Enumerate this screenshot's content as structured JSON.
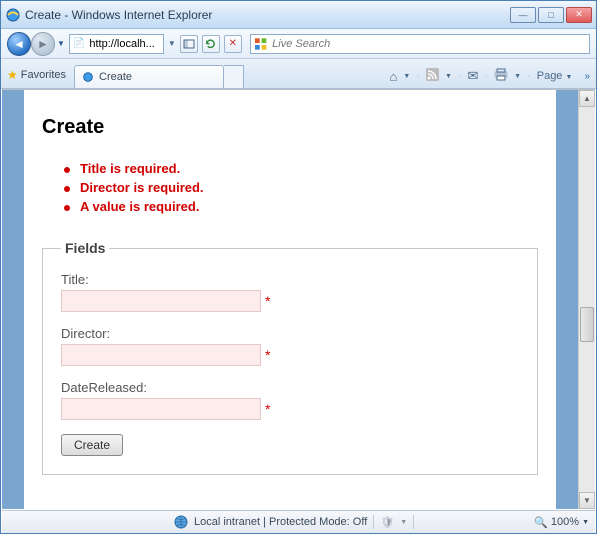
{
  "window": {
    "title": "Create - Windows Internet Explorer"
  },
  "nav": {
    "url": "http://localh...",
    "search_placeholder": "Live Search"
  },
  "tabs": {
    "favorites_label": "Favorites",
    "active_tab_title": "Create"
  },
  "toolbar": {
    "page_menu": "Page"
  },
  "page": {
    "heading": "Create",
    "errors": [
      "Title is required.",
      "Director is required.",
      "A value is required."
    ],
    "fieldset_legend": "Fields",
    "fields": {
      "title": {
        "label": "Title:",
        "value": ""
      },
      "director": {
        "label": "Director:",
        "value": ""
      },
      "date_released": {
        "label": "DateReleased:",
        "value": ""
      }
    },
    "submit_label": "Create"
  },
  "status": {
    "zone_text": "Local intranet | Protected Mode: Off",
    "zoom": "100%"
  }
}
